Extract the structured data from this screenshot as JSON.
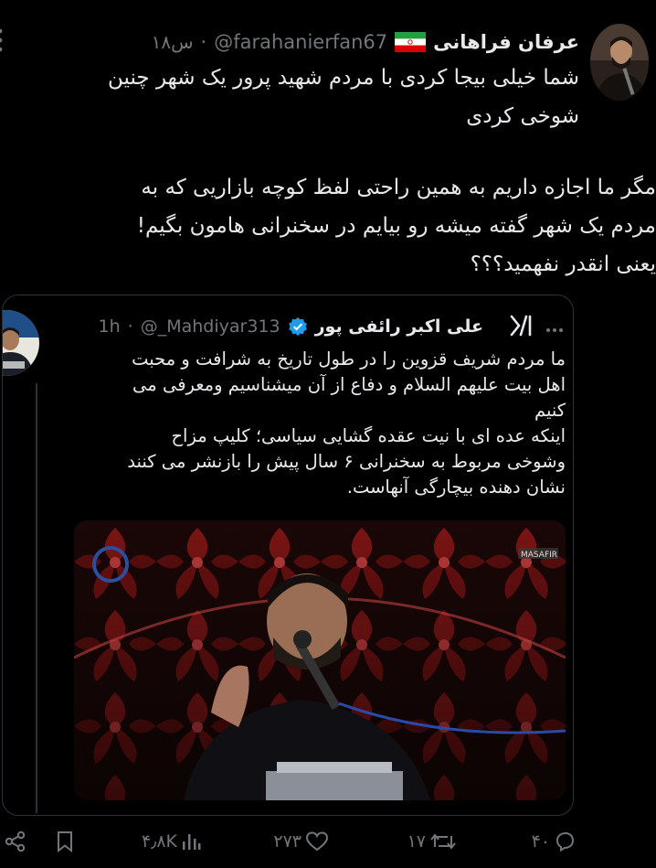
{
  "tweet": {
    "author_name": "عرفان فراهانی",
    "handle": "@farahanierfan67",
    "time": "۱۸س",
    "text_para1_line1": "شما خیلی بیجا کردی با مردم شهید پرور یک شهر چنین",
    "text_para1_line2": "شوخی کردی",
    "text_para2_line1": "مگر ما اجازه داریم به همین راحتی لفظ کوچه بازاریی که به",
    "text_para2_line2": "مردم یک شهر گفته میشه رو بیایم در سخنرانی هامون بگیم!",
    "text_para2_line3": "یعنی انقدر نفهمید؟؟؟"
  },
  "quoted": {
    "author_name": "علی اکبر رائفی پور",
    "handle": "@_Mahdiyar313",
    "time": "1h",
    "lines": [
      "ما مردم شریف قزوین را در طول تاریخ به شرافت و محبت",
      "اهل بیت علیهم السلام و دفاع از آن میشناسیم ومعرفی می",
      "کنیم",
      "اینکه عده ای با نیت عقده گشایی سیاسی؛ کلیپ مزاح",
      "وشوخی مربوط به سخنرانی ۶ سال پیش را بازنشر می کنند",
      "نشان دهنده بیچارگی آنهاست."
    ],
    "media_watermark": "MASAFIR"
  },
  "actions": {
    "replies": "۴۰",
    "reposts": "۱۷",
    "likes": "۲۷۳",
    "views": "۴٫۸K"
  },
  "icons": {
    "more": "more-vertical-icon",
    "flag": "iran-flag-icon",
    "verified": "verified-badge-icon",
    "x_logo": "x-grok-logo-icon",
    "reply": "reply-icon",
    "repost": "repost-icon",
    "like": "like-icon",
    "views": "views-icon",
    "bookmark": "bookmark-icon",
    "share": "share-icon"
  },
  "colors": {
    "background": "#000000",
    "text": "#e7e9ea",
    "muted": "#71767b",
    "border": "#2f3336",
    "verified": "#1d9bf0"
  }
}
